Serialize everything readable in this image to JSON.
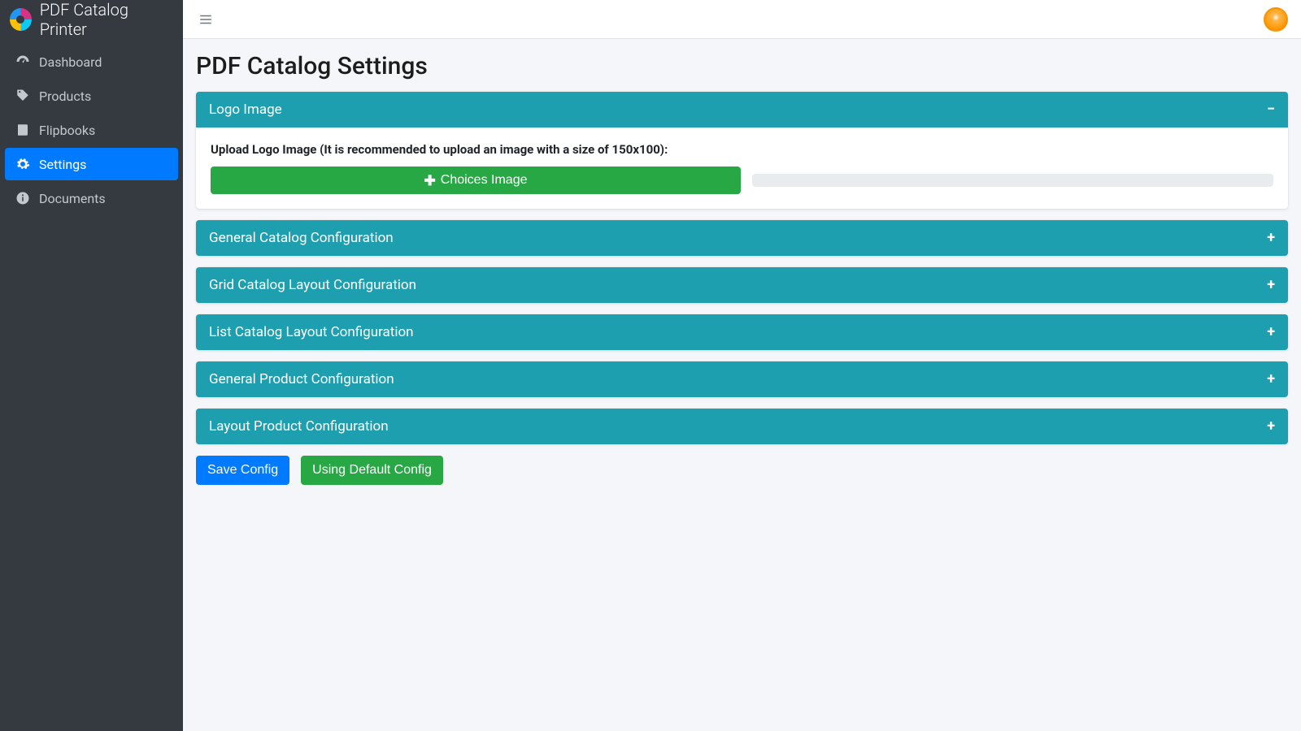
{
  "brand": {
    "title": "PDF Catalog Printer"
  },
  "sidebar": {
    "items": [
      {
        "label": "Dashboard",
        "icon": "dashboard"
      },
      {
        "label": "Products",
        "icon": "tag"
      },
      {
        "label": "Flipbooks",
        "icon": "book"
      },
      {
        "label": "Settings",
        "icon": "gear",
        "active": true
      },
      {
        "label": "Documents",
        "icon": "info"
      }
    ]
  },
  "page": {
    "title": "PDF Catalog Settings"
  },
  "sections": {
    "logo": {
      "title": "Logo Image",
      "upload_label": "Upload Logo Image (It is recommended to upload an image with a size of 150x100):",
      "upload_button": "Choices Image"
    },
    "general_catalog": {
      "title": "General Catalog Configuration"
    },
    "grid_catalog": {
      "title": "Grid Catalog Layout Configuration"
    },
    "list_catalog": {
      "title": "List Catalog Layout Configuration"
    },
    "general_product": {
      "title": "General Product Configuration"
    },
    "layout_product": {
      "title": "Layout Product Configuration"
    }
  },
  "actions": {
    "save": "Save Config",
    "default": "Using Default Config"
  }
}
